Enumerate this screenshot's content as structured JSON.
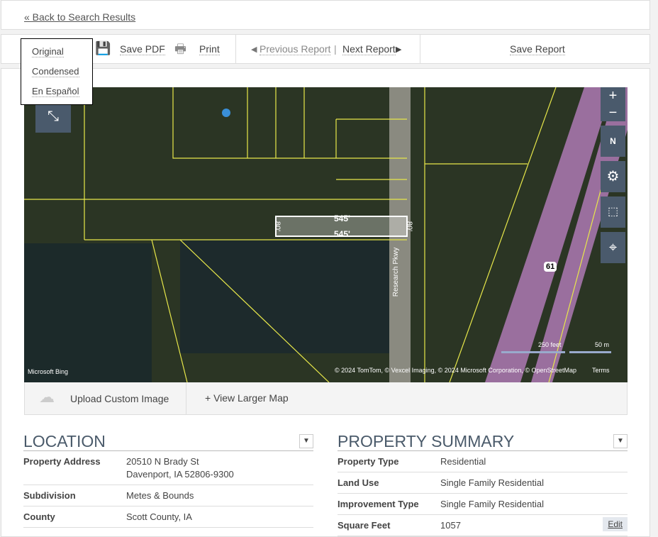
{
  "back_link": "« Back to Search Results",
  "toolbar": {
    "save_pdf": "Save PDF",
    "print": "Print",
    "previous": "Previous Report",
    "next": "Next Report",
    "save_report": "Save Report"
  },
  "menu": [
    "Original",
    "Condensed",
    "En Español"
  ],
  "map": {
    "dimension_long": "545'",
    "dimension_short": "80'",
    "road": "Research Pkwy",
    "highway": "61",
    "scale_ft": "250 feet",
    "scale_m": "50 m",
    "attribution": "© 2024 TomTom, © Vexcel Imaging, © 2024 Microsoft Corporation, © OpenStreetMap",
    "terms": "Terms",
    "logo": "Microsoft Bing",
    "compass": "N"
  },
  "map_actions": {
    "upload": "Upload Custom Image",
    "larger": "+ View Larger Map"
  },
  "location": {
    "title": "LOCATION",
    "rows": [
      {
        "label": "Property Address",
        "value": "20510 N Brady St",
        "value2": "Davenport, IA 52806-9300"
      },
      {
        "label": "Subdivision",
        "value": "Metes & Bounds"
      },
      {
        "label": "County",
        "value": "Scott County, IA"
      }
    ]
  },
  "summary": {
    "title": "PROPERTY SUMMARY",
    "edit": "Edit",
    "rows": [
      {
        "label": "Property Type",
        "value": "Residential"
      },
      {
        "label": "Land Use",
        "value": "Single Family Residential"
      },
      {
        "label": "Improvement Type",
        "value": "Single Family Residential"
      },
      {
        "label": "Square Feet",
        "value": "1057"
      }
    ]
  }
}
